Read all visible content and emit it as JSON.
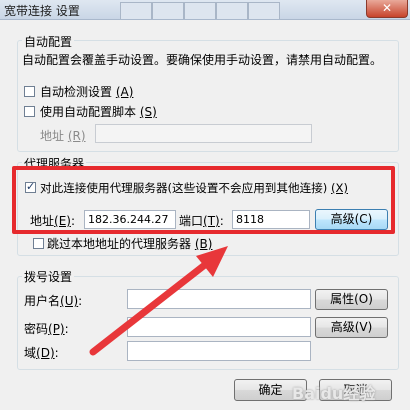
{
  "window": {
    "title": "宽带连接 设置",
    "close_label": "✕"
  },
  "auto_config": {
    "group_label": "自动配置",
    "description": "自动配置会覆盖手动设置。要确保使用手动设置，请禁用自动配置。",
    "auto_detect": {
      "label": "自动检测设置",
      "hotkey": "(A)",
      "checked": false
    },
    "use_script": {
      "label": "使用自动配置脚本",
      "hotkey": "(S)",
      "checked": false
    },
    "address_label": "地址",
    "address_hotkey": "(R)",
    "address_value": ""
  },
  "proxy": {
    "group_label": "代理服务器",
    "use_proxy": {
      "label": "对此连接使用代理服务器(这些设置不会应用到其他连接)",
      "hotkey": "(X)",
      "checked": true
    },
    "address_label": "地址",
    "address_hotkey": "(E)",
    "address_value": "182.36.244.27",
    "port_label": "端口",
    "port_hotkey": "(T)",
    "port_value": "8118",
    "advanced_button": "高级(C)",
    "bypass_local": {
      "label": "跳过本地地址的代理服务器",
      "hotkey": "(B)",
      "checked": false
    }
  },
  "dialup": {
    "group_label": "拨号设置",
    "username_label": "用户名",
    "username_hotkey": "(U)",
    "username_value": "",
    "password_label": "密码",
    "password_hotkey": "(P)",
    "password_value": "",
    "domain_label": "域",
    "domain_hotkey": "(D)",
    "domain_value": "",
    "properties_button": "属性(O)",
    "advanced_button": "高级(V)"
  },
  "footer": {
    "ok_button": "确定",
    "cancel_button": "取消"
  },
  "watermark": "Baidu经验",
  "colors": {
    "highlight_red": "#e62a2e",
    "arrow_red": "#e8373a"
  }
}
